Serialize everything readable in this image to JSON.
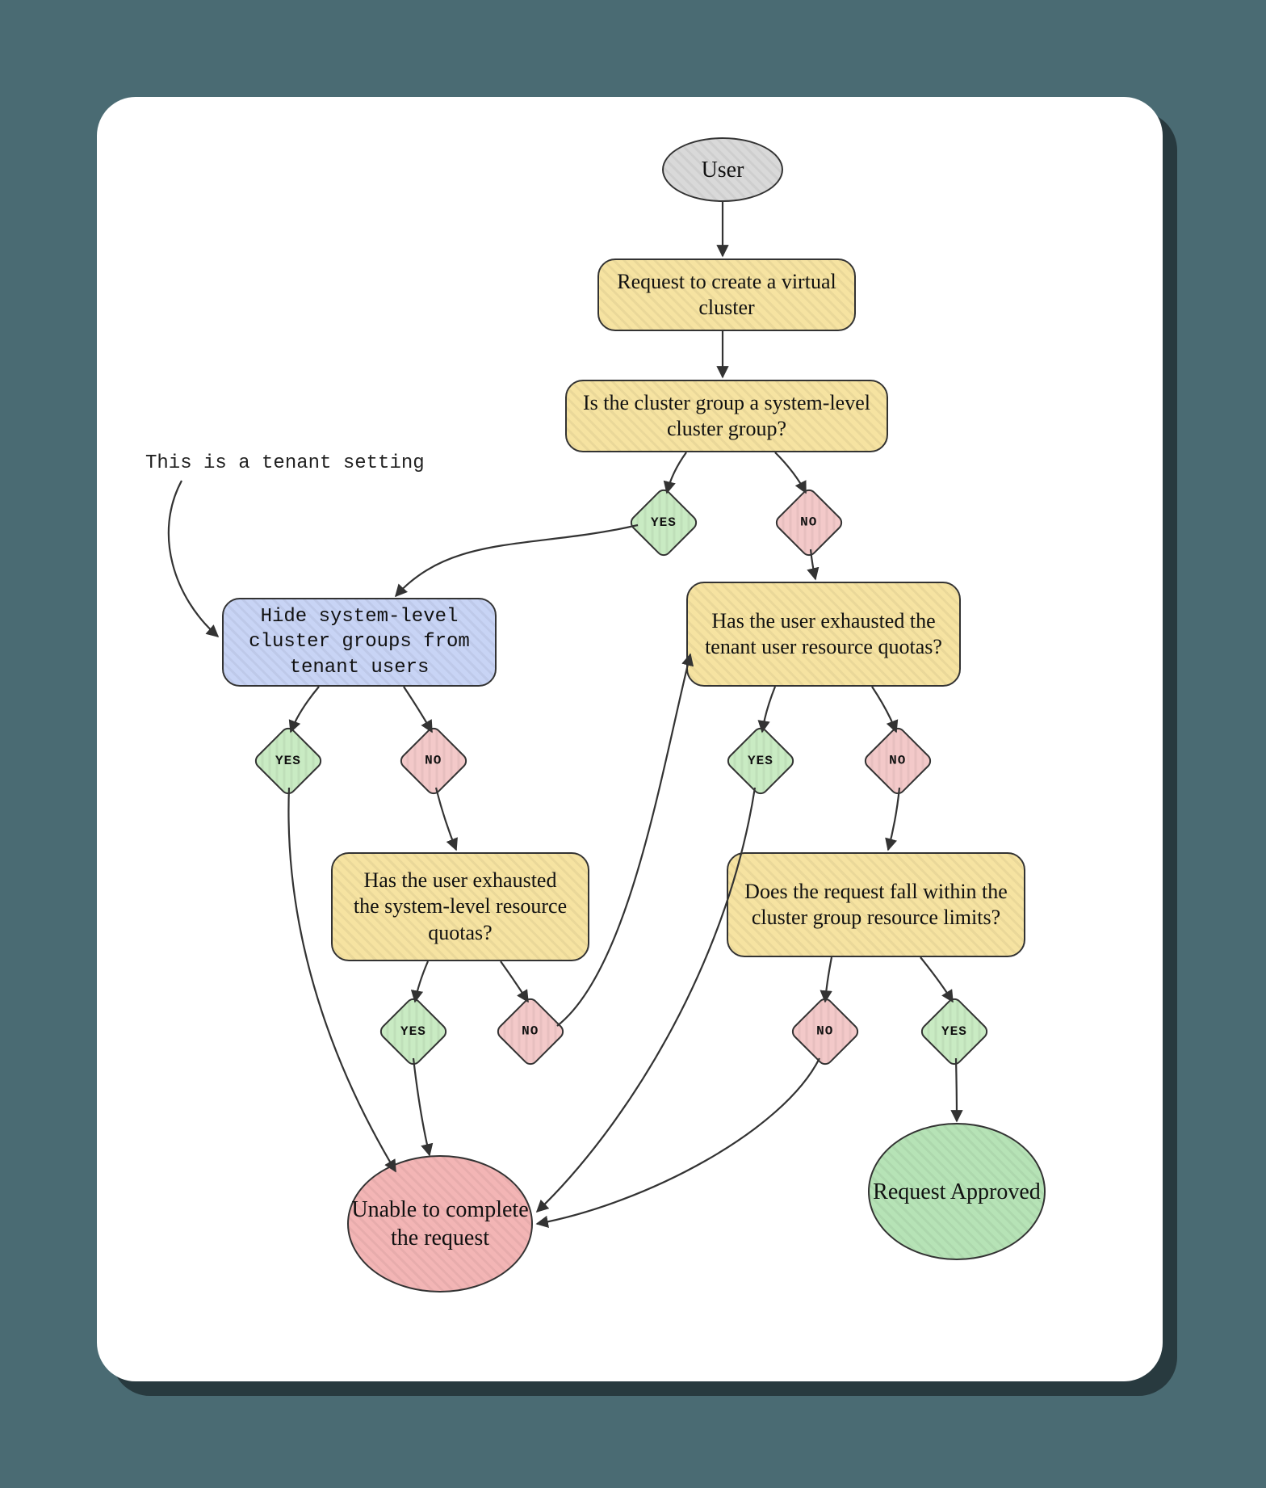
{
  "annotation": "This is a tenant setting",
  "yes": "YES",
  "no": "NO",
  "nodes": {
    "user": "User",
    "request": "Request to create a virtual cluster",
    "isSystem": "Is the cluster group a system-level cluster group?",
    "hideSetting": "Hide system-level cluster groups from tenant users",
    "sysQuota": "Has the user exhausted the system-level resource quotas?",
    "tenantQuota": "Has the user exhausted the tenant user resource quotas?",
    "withinLimits": "Does the request fall within the cluster group resource limits?",
    "unable": "Unable to complete the request",
    "approved": "Request Approved"
  },
  "colors": {
    "bgPage": "#4a6b73",
    "card": "#ffffff",
    "yellow": "#f6e3a1",
    "blue": "#c8d4f5",
    "green": "#b6e3b6",
    "red": "#f3b5b5",
    "grey": "#d9d9d9",
    "diamondYes": "#c9ebc3",
    "diamondNo": "#f3c9c9"
  }
}
